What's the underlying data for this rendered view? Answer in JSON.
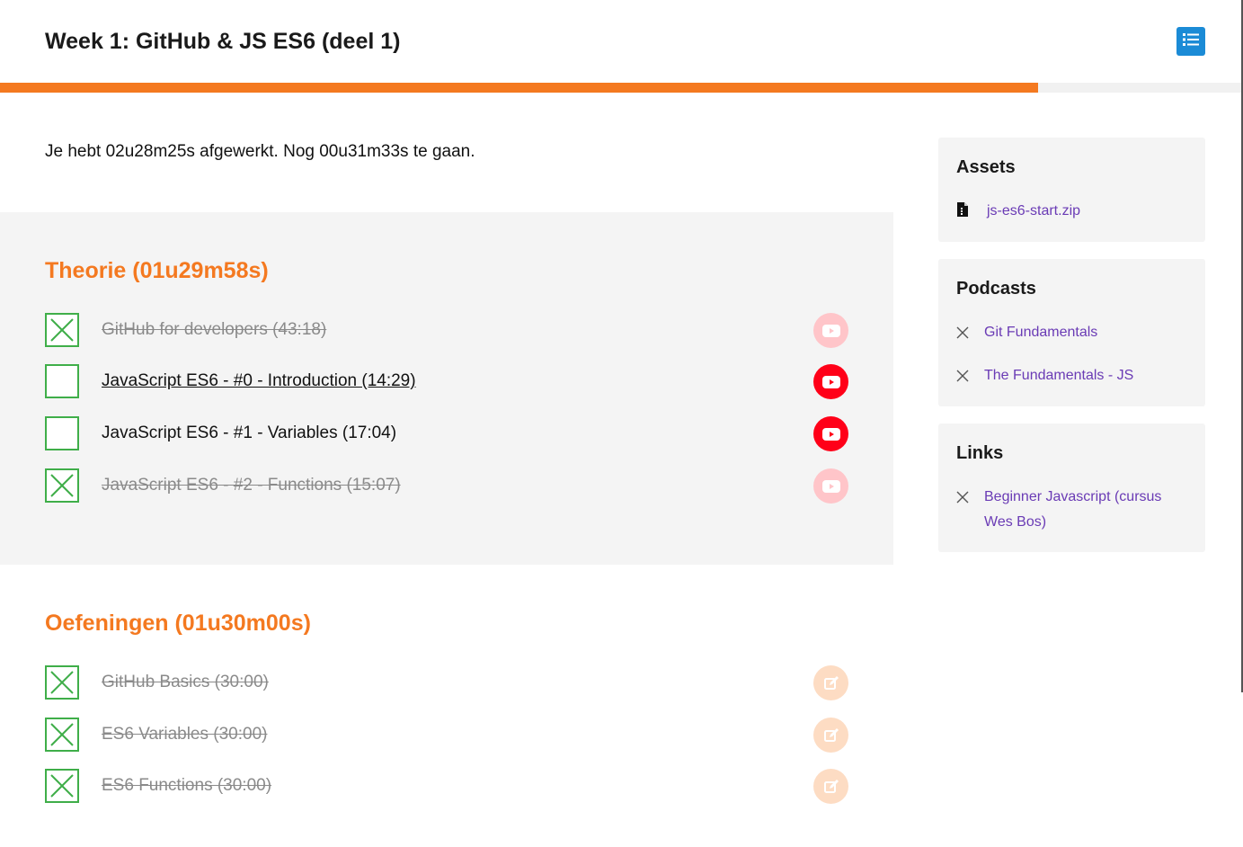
{
  "header": {
    "title": "Week 1: GitHub & JS ES6 (deel 1)",
    "menu_icon": "list-icon",
    "accent": "#1b8bd6"
  },
  "progress": {
    "fraction": 0.835,
    "color": "#f47920"
  },
  "summary": "Je hebt 02u28m25s afgewerkt. Nog 00u31m33s te gaan.",
  "theory": {
    "title": "Theorie (01u29m58s)",
    "items": [
      {
        "label": "GitHub for developers (43:18)",
        "done": true,
        "icon": "youtube-icon"
      },
      {
        "label": "JavaScript ES6 - #0 - Introduction (14:29)",
        "done": false,
        "icon": "youtube-icon"
      },
      {
        "label": "JavaScript ES6 - #1 - Variables (17:04)",
        "done": false,
        "icon": "youtube-icon"
      },
      {
        "label": "JavaScript ES6 - #2 - Functions (15:07)",
        "done": true,
        "icon": "youtube-icon"
      }
    ]
  },
  "exercises": {
    "title": "Oefeningen (01u30m00s)",
    "items": [
      {
        "label": "GitHub Basics (30:00)",
        "done": true,
        "icon": "edit-icon"
      },
      {
        "label": "ES6 Variables (30:00)",
        "done": true,
        "icon": "edit-icon"
      },
      {
        "label": "ES6 Functions (30:00)",
        "done": true,
        "icon": "edit-icon"
      }
    ]
  },
  "sidebar": {
    "assets": {
      "title": "Assets",
      "items": [
        {
          "label": "js-es6-start.zip",
          "icon": "file-icon"
        }
      ]
    },
    "podcasts": {
      "title": "Podcasts",
      "items": [
        {
          "label": "Git Fundamentals",
          "icon": "close-icon"
        },
        {
          "label": "The Fundamentals - JS",
          "icon": "close-icon"
        }
      ]
    },
    "links": {
      "title": "Links",
      "items": [
        {
          "label": "Beginner Javascript (cursus Wes Bos)",
          "icon": "close-icon"
        }
      ]
    }
  }
}
